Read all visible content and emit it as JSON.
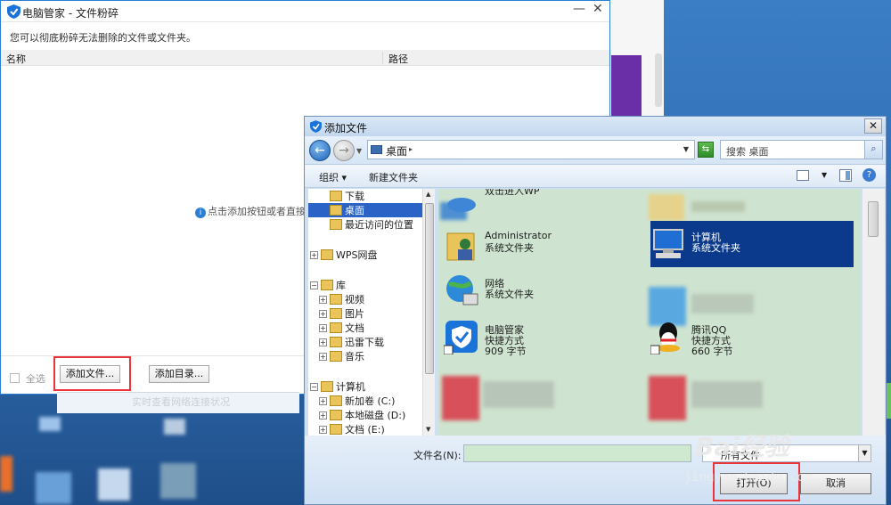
{
  "pc_manager": {
    "app_name": "电脑管家",
    "title_sep": "-",
    "window_title": "文件粉碎",
    "minimize": "—",
    "close": "✕",
    "description": "您可以彻底粉碎无法删除的文件或文件夹。",
    "columns": [
      "名称",
      "路径"
    ],
    "hint": "点击添加按钮或者直接",
    "select_all": "全选",
    "add_file_button": "添加文件...",
    "add_folder_button": "添加目录...",
    "behind_strip_text": "实时查看网络连接状况"
  },
  "dialog": {
    "title": "添加文件",
    "close": "✕",
    "back": "←",
    "forward": "→",
    "address": "桌面",
    "search_placeholder": "搜索 桌面",
    "organize": "组织 ▾",
    "new_folder": "新建文件夹",
    "help": "?",
    "tree": [
      {
        "label": "下载",
        "indent": 1,
        "expander": ""
      },
      {
        "label": "桌面",
        "indent": 1,
        "expander": "",
        "selected": true
      },
      {
        "label": "最近访问的位置",
        "indent": 1,
        "expander": ""
      },
      {
        "label": "",
        "indent": 0,
        "expander": ""
      },
      {
        "label": "WPS网盘",
        "indent": 0,
        "expander": "+"
      },
      {
        "label": "",
        "indent": 0,
        "expander": ""
      },
      {
        "label": "库",
        "indent": 0,
        "expander": "−"
      },
      {
        "label": "视频",
        "indent": 1,
        "expander": "+"
      },
      {
        "label": "图片",
        "indent": 1,
        "expander": "+"
      },
      {
        "label": "文档",
        "indent": 1,
        "expander": "+"
      },
      {
        "label": "迅雷下载",
        "indent": 1,
        "expander": "+"
      },
      {
        "label": "音乐",
        "indent": 1,
        "expander": "+"
      },
      {
        "label": "",
        "indent": 0,
        "expander": ""
      },
      {
        "label": "计算机",
        "indent": 0,
        "expander": "−"
      },
      {
        "label": "新加卷 (C:)",
        "indent": 1,
        "expander": "+"
      },
      {
        "label": "本地磁盘 (D:)",
        "indent": 1,
        "expander": "+"
      },
      {
        "label": "文档 (E:)",
        "indent": 1,
        "expander": "+"
      }
    ],
    "files": [
      {
        "name": "双击进入WP",
        "type": "",
        "size": "",
        "icon": "wps-cloud-icon",
        "col": 0,
        "row": 0
      },
      {
        "name": "Administrator",
        "type": "系统文件夹",
        "size": "",
        "icon": "user-folder-icon",
        "col": 0,
        "row": 1
      },
      {
        "name": "计算机",
        "type": "系统文件夹",
        "size": "",
        "icon": "computer-icon",
        "col": 1,
        "row": 1,
        "selected": true
      },
      {
        "name": "网络",
        "type": "系统文件夹",
        "size": "",
        "icon": "network-globe-icon",
        "col": 0,
        "row": 2
      },
      {
        "name": "电脑管家",
        "type": "快捷方式",
        "size": "909 字节",
        "icon": "pc-manager-shield-icon",
        "col": 0,
        "row": 3
      },
      {
        "name": "腾讯QQ",
        "type": "快捷方式",
        "size": "660 字节",
        "icon": "qq-penguin-icon",
        "col": 1,
        "row": 3
      }
    ],
    "filename_label": "文件名(N):",
    "filename_value": "",
    "filetype_value": "所有文件",
    "open_button": "打开(O)",
    "cancel_button": "取消"
  },
  "watermark": {
    "brand": "Bai经验",
    "url": "jingyan.baidu.com"
  },
  "colors": {
    "accent": "#2a7fd4",
    "highlight": "#e8343a",
    "selection": "#0b3a8c"
  }
}
